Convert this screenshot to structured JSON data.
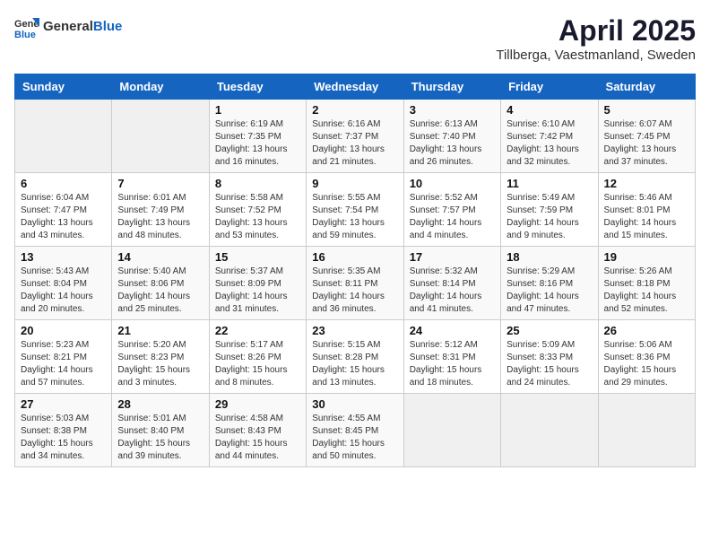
{
  "logo": {
    "general": "General",
    "blue": "Blue"
  },
  "header": {
    "month": "April 2025",
    "location": "Tillberga, Vaestmanland, Sweden"
  },
  "weekdays": [
    "Sunday",
    "Monday",
    "Tuesday",
    "Wednesday",
    "Thursday",
    "Friday",
    "Saturday"
  ],
  "weeks": [
    [
      {
        "day": "",
        "info": ""
      },
      {
        "day": "",
        "info": ""
      },
      {
        "day": "1",
        "info": "Sunrise: 6:19 AM\nSunset: 7:35 PM\nDaylight: 13 hours and 16 minutes."
      },
      {
        "day": "2",
        "info": "Sunrise: 6:16 AM\nSunset: 7:37 PM\nDaylight: 13 hours and 21 minutes."
      },
      {
        "day": "3",
        "info": "Sunrise: 6:13 AM\nSunset: 7:40 PM\nDaylight: 13 hours and 26 minutes."
      },
      {
        "day": "4",
        "info": "Sunrise: 6:10 AM\nSunset: 7:42 PM\nDaylight: 13 hours and 32 minutes."
      },
      {
        "day": "5",
        "info": "Sunrise: 6:07 AM\nSunset: 7:45 PM\nDaylight: 13 hours and 37 minutes."
      }
    ],
    [
      {
        "day": "6",
        "info": "Sunrise: 6:04 AM\nSunset: 7:47 PM\nDaylight: 13 hours and 43 minutes."
      },
      {
        "day": "7",
        "info": "Sunrise: 6:01 AM\nSunset: 7:49 PM\nDaylight: 13 hours and 48 minutes."
      },
      {
        "day": "8",
        "info": "Sunrise: 5:58 AM\nSunset: 7:52 PM\nDaylight: 13 hours and 53 minutes."
      },
      {
        "day": "9",
        "info": "Sunrise: 5:55 AM\nSunset: 7:54 PM\nDaylight: 13 hours and 59 minutes."
      },
      {
        "day": "10",
        "info": "Sunrise: 5:52 AM\nSunset: 7:57 PM\nDaylight: 14 hours and 4 minutes."
      },
      {
        "day": "11",
        "info": "Sunrise: 5:49 AM\nSunset: 7:59 PM\nDaylight: 14 hours and 9 minutes."
      },
      {
        "day": "12",
        "info": "Sunrise: 5:46 AM\nSunset: 8:01 PM\nDaylight: 14 hours and 15 minutes."
      }
    ],
    [
      {
        "day": "13",
        "info": "Sunrise: 5:43 AM\nSunset: 8:04 PM\nDaylight: 14 hours and 20 minutes."
      },
      {
        "day": "14",
        "info": "Sunrise: 5:40 AM\nSunset: 8:06 PM\nDaylight: 14 hours and 25 minutes."
      },
      {
        "day": "15",
        "info": "Sunrise: 5:37 AM\nSunset: 8:09 PM\nDaylight: 14 hours and 31 minutes."
      },
      {
        "day": "16",
        "info": "Sunrise: 5:35 AM\nSunset: 8:11 PM\nDaylight: 14 hours and 36 minutes."
      },
      {
        "day": "17",
        "info": "Sunrise: 5:32 AM\nSunset: 8:14 PM\nDaylight: 14 hours and 41 minutes."
      },
      {
        "day": "18",
        "info": "Sunrise: 5:29 AM\nSunset: 8:16 PM\nDaylight: 14 hours and 47 minutes."
      },
      {
        "day": "19",
        "info": "Sunrise: 5:26 AM\nSunset: 8:18 PM\nDaylight: 14 hours and 52 minutes."
      }
    ],
    [
      {
        "day": "20",
        "info": "Sunrise: 5:23 AM\nSunset: 8:21 PM\nDaylight: 14 hours and 57 minutes."
      },
      {
        "day": "21",
        "info": "Sunrise: 5:20 AM\nSunset: 8:23 PM\nDaylight: 15 hours and 3 minutes."
      },
      {
        "day": "22",
        "info": "Sunrise: 5:17 AM\nSunset: 8:26 PM\nDaylight: 15 hours and 8 minutes."
      },
      {
        "day": "23",
        "info": "Sunrise: 5:15 AM\nSunset: 8:28 PM\nDaylight: 15 hours and 13 minutes."
      },
      {
        "day": "24",
        "info": "Sunrise: 5:12 AM\nSunset: 8:31 PM\nDaylight: 15 hours and 18 minutes."
      },
      {
        "day": "25",
        "info": "Sunrise: 5:09 AM\nSunset: 8:33 PM\nDaylight: 15 hours and 24 minutes."
      },
      {
        "day": "26",
        "info": "Sunrise: 5:06 AM\nSunset: 8:36 PM\nDaylight: 15 hours and 29 minutes."
      }
    ],
    [
      {
        "day": "27",
        "info": "Sunrise: 5:03 AM\nSunset: 8:38 PM\nDaylight: 15 hours and 34 minutes."
      },
      {
        "day": "28",
        "info": "Sunrise: 5:01 AM\nSunset: 8:40 PM\nDaylight: 15 hours and 39 minutes."
      },
      {
        "day": "29",
        "info": "Sunrise: 4:58 AM\nSunset: 8:43 PM\nDaylight: 15 hours and 44 minutes."
      },
      {
        "day": "30",
        "info": "Sunrise: 4:55 AM\nSunset: 8:45 PM\nDaylight: 15 hours and 50 minutes."
      },
      {
        "day": "",
        "info": ""
      },
      {
        "day": "",
        "info": ""
      },
      {
        "day": "",
        "info": ""
      }
    ]
  ]
}
